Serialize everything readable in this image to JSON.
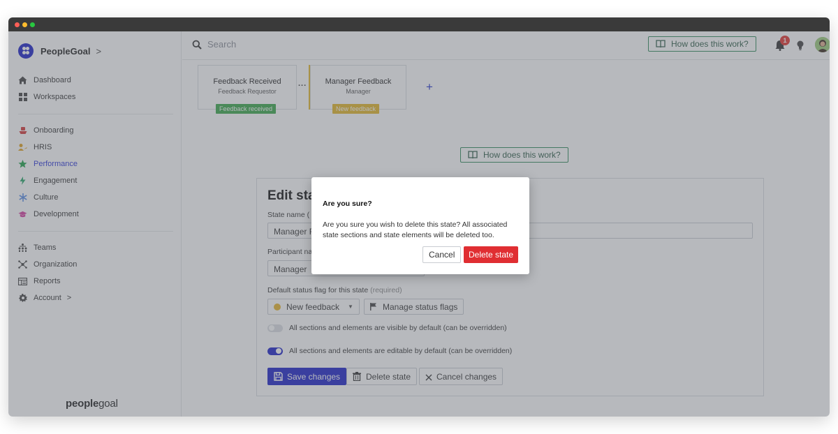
{
  "org": {
    "name": "PeopleGoal",
    "chevron": ">"
  },
  "nav_primary": [
    {
      "label": "Dashboard",
      "icon": "home-icon"
    },
    {
      "label": "Workspaces",
      "icon": "grid-icon"
    }
  ],
  "nav_apps": [
    {
      "label": "Onboarding",
      "icon": "ship-icon",
      "color": "#d33"
    },
    {
      "label": "HRIS",
      "icon": "users-icon",
      "color": "#e0a020"
    },
    {
      "label": "Performance",
      "icon": "star-icon",
      "color": "#1fa34a",
      "active": true
    },
    {
      "label": "Engagement",
      "icon": "lightning-icon",
      "color": "#2aa86a"
    },
    {
      "label": "Culture",
      "icon": "snowflake-icon",
      "color": "#5b8fe6"
    },
    {
      "label": "Development",
      "icon": "graduation-cap-icon",
      "color": "#d53fa0"
    }
  ],
  "nav_admin": [
    {
      "label": "Teams",
      "icon": "org-tree-icon"
    },
    {
      "label": "Organization",
      "icon": "network-icon"
    },
    {
      "label": "Reports",
      "icon": "table-icon"
    },
    {
      "label": "Account",
      "icon": "gear-icon",
      "chevron": ">"
    }
  ],
  "brand": {
    "bold": "people",
    "regular": "goal"
  },
  "topbar": {
    "search_placeholder": "Search",
    "how_label": "How does this work?",
    "notification_count": "1"
  },
  "workflow": {
    "cards": [
      {
        "title": "Feedback Received",
        "subtitle": "Feedback Requestor",
        "tag": "Feedback received",
        "tag_color": "#3aa84a"
      },
      {
        "title": "Manager Feedback",
        "subtitle": "Manager",
        "tag": "New feedback",
        "tag_color": "#e4b627"
      }
    ],
    "ellipsis": "...",
    "add": "+"
  },
  "how_center_label": "How does this work?",
  "edit": {
    "title": "Edit sta",
    "state_name_label": "State name (",
    "state_name_value": "Manager F",
    "participant_label": "Participant na",
    "participant_value": "Manager",
    "status_flag_label": "Default status flag for this state",
    "status_flag_required": "(required)",
    "status_flag_value": "New feedback",
    "manage_flags": "Manage status flags",
    "toggle_visible": {
      "label": "All sections and elements are visible by default (can be overridden)",
      "on": false
    },
    "toggle_editable": {
      "label": "All sections and elements are editable by default (can be overridden)",
      "on": true
    },
    "save": "Save changes",
    "delete": "Delete state",
    "cancel": "Cancel changes"
  },
  "modal": {
    "title": "Are you sure?",
    "body": "Are you sure you wish to delete this state? All associated state sections and state elements will be deleted too.",
    "cancel": "Cancel",
    "confirm": "Delete state"
  }
}
